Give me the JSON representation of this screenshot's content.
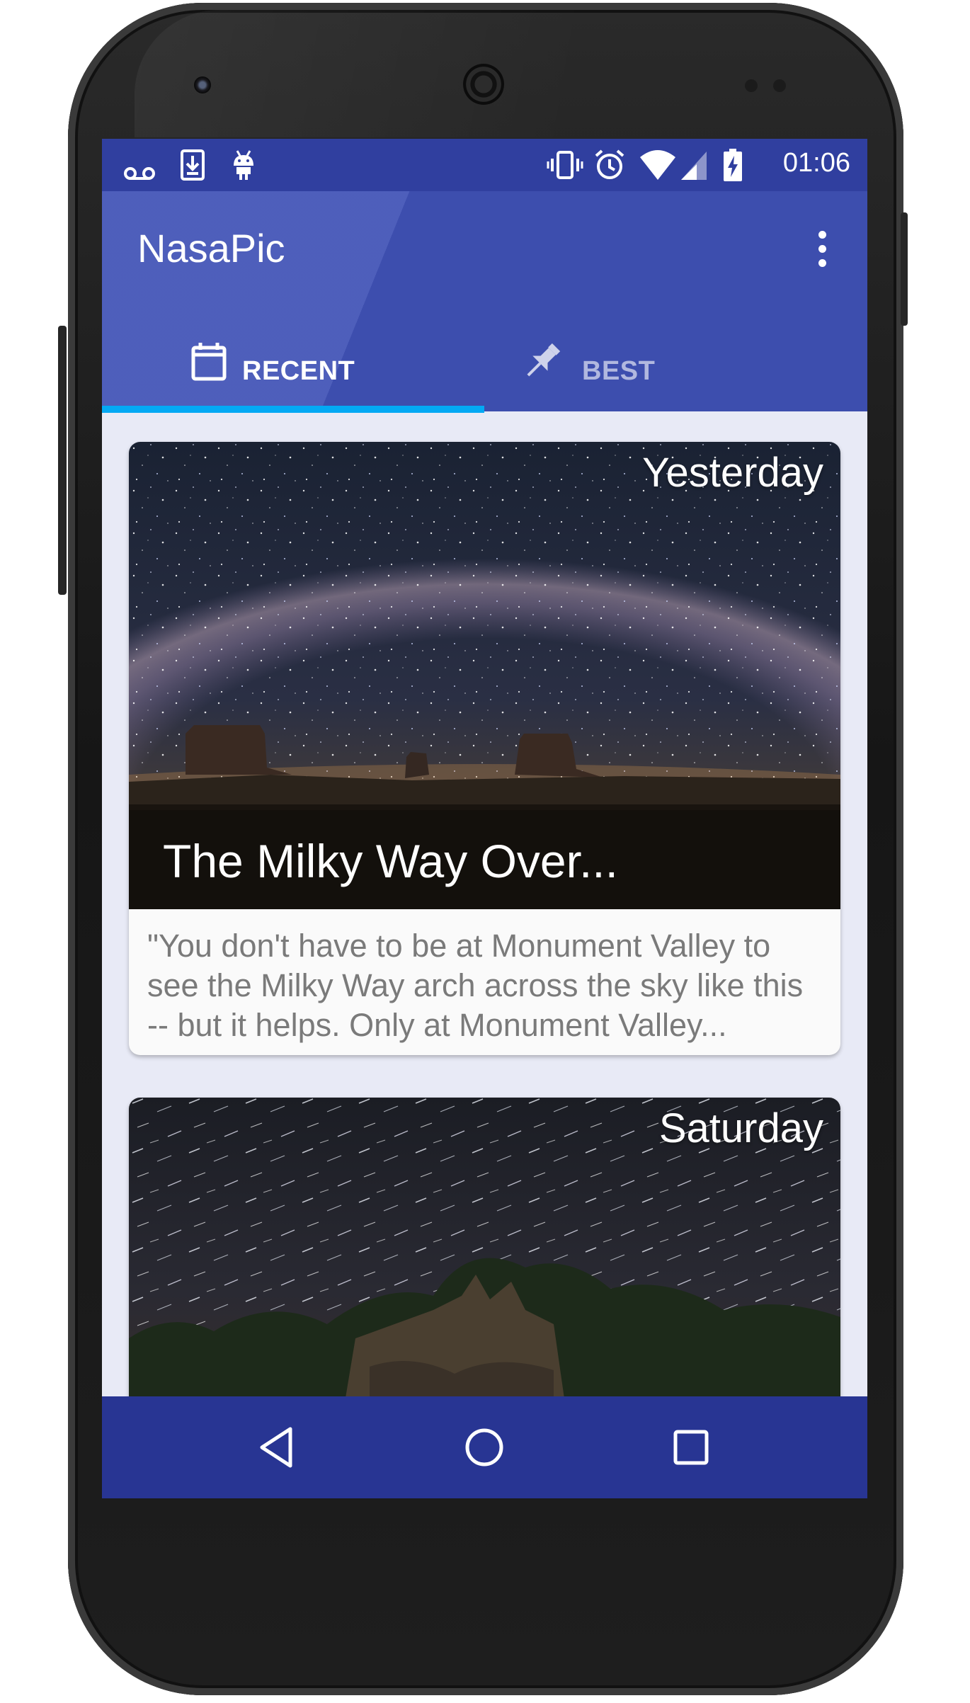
{
  "statusbar": {
    "time": "01:06",
    "left_icons": [
      "voicemail-icon",
      "download-icon",
      "android-icon"
    ],
    "right_icons": [
      "vibrate-icon",
      "alarm-icon",
      "wifi-icon",
      "signal-icon",
      "battery-charging-icon"
    ]
  },
  "appbar": {
    "title": "NasaPic",
    "menu_icon": "more-vert-icon"
  },
  "tabs": [
    {
      "label": "RECENT",
      "icon": "calendar-icon",
      "selected": true
    },
    {
      "label": "BEST",
      "icon": "pin-icon",
      "selected": false
    }
  ],
  "cards": [
    {
      "date": "Yesterday",
      "title": "The Milky Way Over...",
      "description": "\"You don't have to be at Monument Valley to see the Milky Way arch across the sky like this -- but it helps. Only at Monument Valley..."
    },
    {
      "date": "Saturday"
    }
  ],
  "navbar": {
    "buttons": [
      "back-icon",
      "home-icon",
      "recents-icon"
    ]
  },
  "colors": {
    "primary": "#3f51b5",
    "primary_dark": "#303f9f",
    "nav": "#283593",
    "accent": "#03a9f4",
    "background": "#e8eaf6"
  }
}
